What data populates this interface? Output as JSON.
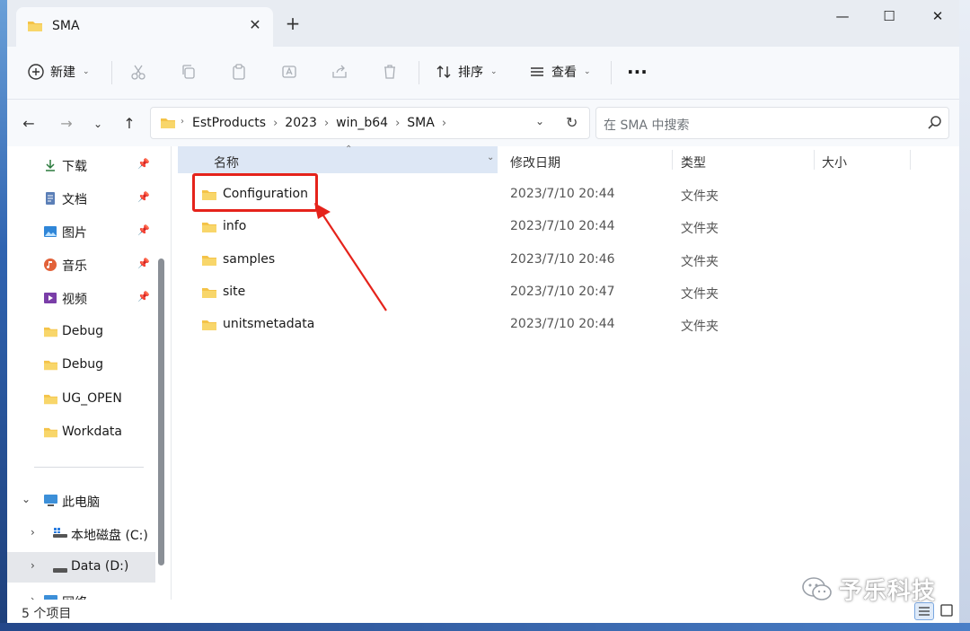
{
  "tab": {
    "title": "SMA",
    "close": "✕",
    "add": "+"
  },
  "window_controls": {
    "minimize": "—",
    "maximize": "☐",
    "close": "✕"
  },
  "toolbar": {
    "new_label": "新建",
    "sort_label": "排序",
    "view_label": "查看",
    "more": "···"
  },
  "address": {
    "crumbs": [
      "EstProducts",
      "2023",
      "win_b64",
      "SMA"
    ],
    "search_placeholder": "在 SMA 中搜索"
  },
  "sidebar": {
    "quick": [
      {
        "label": "下载",
        "icon": "download-icon",
        "pinned": true
      },
      {
        "label": "文档",
        "icon": "document-icon",
        "pinned": true
      },
      {
        "label": "图片",
        "icon": "picture-icon",
        "pinned": true
      },
      {
        "label": "音乐",
        "icon": "music-icon",
        "pinned": true
      },
      {
        "label": "视频",
        "icon": "video-icon",
        "pinned": true
      },
      {
        "label": "Debug",
        "icon": "folder-icon",
        "pinned": false
      },
      {
        "label": "Debug",
        "icon": "folder-icon",
        "pinned": false
      },
      {
        "label": "UG_OPEN",
        "icon": "folder-icon",
        "pinned": false
      },
      {
        "label": "Workdata",
        "icon": "folder-icon",
        "pinned": false
      }
    ],
    "this_pc": "此电脑",
    "drives": [
      {
        "label": "本地磁盘 (C:)",
        "selected": false
      },
      {
        "label": "Data (D:)",
        "selected": true
      }
    ],
    "network": "网络"
  },
  "columns": {
    "name": "名称",
    "date": "修改日期",
    "type": "类型",
    "size": "大小"
  },
  "files": [
    {
      "name": "Configuration",
      "date": "2023/7/10 20:44",
      "type": "文件夹"
    },
    {
      "name": "info",
      "date": "2023/7/10 20:44",
      "type": "文件夹"
    },
    {
      "name": "samples",
      "date": "2023/7/10 20:46",
      "type": "文件夹"
    },
    {
      "name": "site",
      "date": "2023/7/10 20:47",
      "type": "文件夹"
    },
    {
      "name": "unitsmetadata",
      "date": "2023/7/10 20:44",
      "type": "文件夹"
    }
  ],
  "status": {
    "count": "5 个项目"
  },
  "watermark": {
    "text": "予乐科技"
  },
  "colors": {
    "accent_red": "#e5231b",
    "folder": "#f4c348",
    "header_sel": "#dde7f5"
  }
}
